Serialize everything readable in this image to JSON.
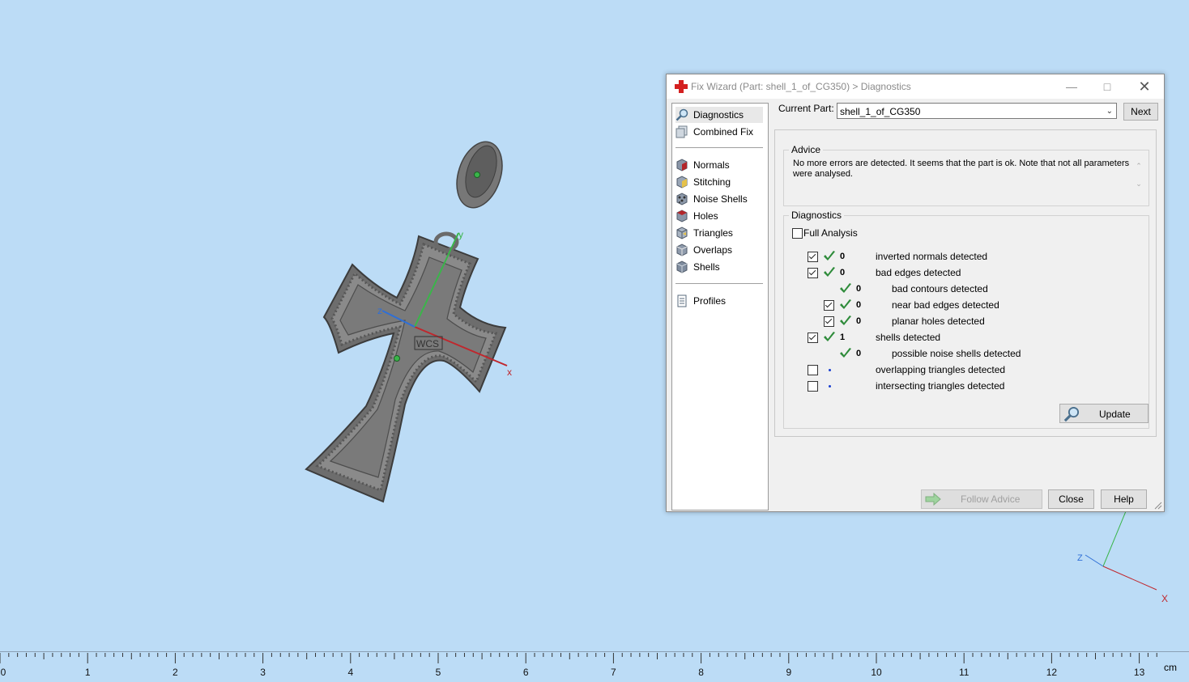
{
  "viewport": {
    "wcs_label": "WCS",
    "axis_x": "x",
    "axis_y": "y",
    "axis_z": "z",
    "mini_axis_x": "X",
    "mini_axis_z": "Z"
  },
  "ruler": {
    "labels": [
      "0",
      "1",
      "2",
      "3",
      "4",
      "5",
      "6",
      "7",
      "8",
      "9",
      "10",
      "11",
      "12",
      "13"
    ],
    "unit": "cm"
  },
  "dialog": {
    "title": "Fix Wizard (Part: shell_1_of_CG350) > Diagnostics",
    "nav": {
      "diagnostics": "Diagnostics",
      "combined_fix": "Combined Fix",
      "normals": "Normals",
      "stitching": "Stitching",
      "noise_shells": "Noise Shells",
      "holes": "Holes",
      "triangles": "Triangles",
      "overlaps": "Overlaps",
      "shells": "Shells",
      "profiles": "Profiles"
    },
    "current_part_label": "Current Part:",
    "current_part_value": "shell_1_of_CG350",
    "next_label": "Next",
    "advice": {
      "title": "Advice",
      "text": "No more errors are detected. It seems that the part is ok. Note that not all parameters were analysed."
    },
    "diagnostics": {
      "title": "Diagnostics",
      "full_analysis": "Full Analysis",
      "full_analysis_checked": false,
      "rows": [
        {
          "count": "0",
          "label": "inverted normals detected"
        },
        {
          "count": "0",
          "label": "bad edges detected"
        },
        {
          "count": "0",
          "label": "bad contours detected"
        },
        {
          "count": "0",
          "label": "near bad edges detected"
        },
        {
          "count": "0",
          "label": "planar holes detected"
        },
        {
          "count": "1",
          "label": "shells detected"
        },
        {
          "count": "0",
          "label": "possible noise shells detected"
        },
        {
          "count": "",
          "label": "overlapping triangles detected"
        },
        {
          "count": "",
          "label": "intersecting triangles detected"
        }
      ],
      "update_label": "Update"
    },
    "follow_advice_label": "Follow Advice",
    "close_label": "Close",
    "help_label": "Help"
  },
  "colors": {
    "background": "#bcdcf6",
    "check_green": "#2e8b3a",
    "axis_x": "#c0272d",
    "axis_y": "#3ab54a",
    "axis_z": "#2f6fd6"
  }
}
